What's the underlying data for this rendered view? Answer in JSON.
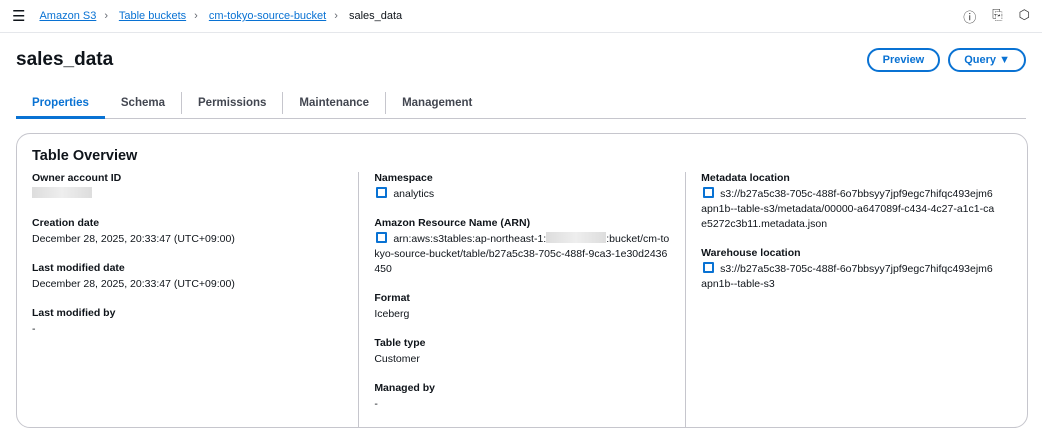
{
  "breadcrumb": [
    "Amazon S3",
    "Table buckets",
    "cm-tokyo-source-bucket",
    "sales_data"
  ],
  "title": "sales_data",
  "buttons": {
    "preview": "Preview",
    "query": "Query ▼"
  },
  "tabs": [
    "Properties",
    "Schema",
    "Permissions",
    "Maintenance",
    "Management"
  ],
  "overview": {
    "heading": "Table Overview",
    "owner_label": "Owner account ID",
    "creation_label": "Creation date",
    "creation": "December 28, 2025, 20:33:47 (UTC+09:00)",
    "modified_label": "Last modified date",
    "modified": "December 28, 2025, 20:33:47 (UTC+09:00)",
    "modified_by_label": "Last modified by",
    "modified_by": "-",
    "namespace_label": "Namespace",
    "namespace": "analytics",
    "arn_label": "Amazon Resource Name (ARN)",
    "arn_prefix": "arn:aws:s3tables:ap-northeast-1:",
    "arn_suffix": ":bucket/cm-tokyo-source-bucket/table/b27a5c38-705c-488f-9ca3-1e30d2436450",
    "format_label": "Format",
    "format": "Iceberg",
    "type_label": "Table type",
    "type": "Customer",
    "managed_label": "Managed by",
    "managed": "-",
    "metadata_label": "Metadata location",
    "metadata": "s3://b27a5c38-705c-488f-6o7bbsyy7jpf9egc7hifqc493ejm6apn1b--table-s3/metadata/00000-a647089f-c434-4c27-a1c1-cae5272c3b11.metadata.json",
    "warehouse_label": "Warehouse location",
    "warehouse": "s3://b27a5c38-705c-488f-6o7bbsyy7jpf9egc7hifqc493ejm6apn1b--table-s3"
  }
}
